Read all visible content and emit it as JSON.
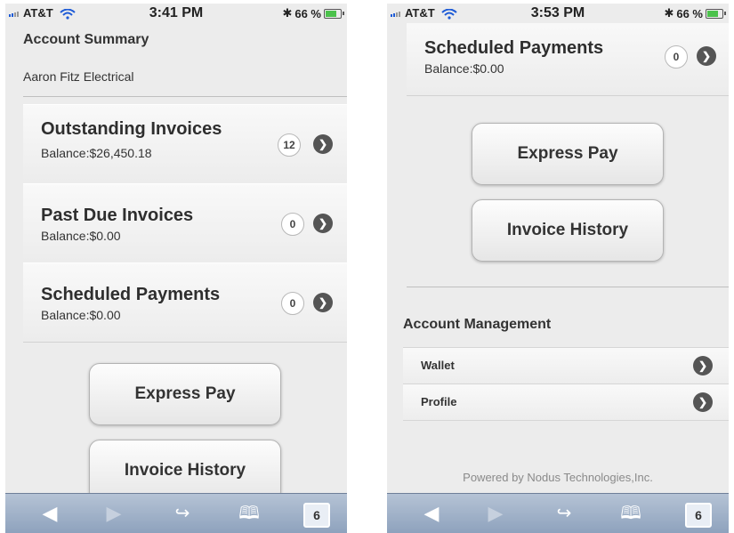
{
  "left": {
    "status": {
      "carrier": "AT&T",
      "time": "3:41 PM",
      "battery": "66 %"
    },
    "title": "Account Summary",
    "account_name": "Aaron Fitz Electrical",
    "rows": [
      {
        "title": "Outstanding Invoices",
        "balance": "Balance:$26,450.18",
        "count": "12"
      },
      {
        "title": "Past Due Invoices",
        "balance": "Balance:$0.00",
        "count": "0"
      },
      {
        "title": "Scheduled Payments",
        "balance": "Balance:$0.00",
        "count": "0"
      }
    ],
    "buttons": {
      "express_pay": "Express Pay",
      "invoice_history": "Invoice History"
    }
  },
  "right": {
    "status": {
      "carrier": "AT&T",
      "time": "3:53 PM",
      "battery": "66 %"
    },
    "row": {
      "title": "Scheduled Payments",
      "balance": "Balance:$0.00",
      "count": "0"
    },
    "buttons": {
      "express_pay": "Express Pay",
      "invoice_history": "Invoice History"
    },
    "management": {
      "title": "Account Management",
      "items": [
        {
          "label": "Wallet"
        },
        {
          "label": "Profile"
        }
      ]
    },
    "footer": "Powered by Nodus Technologies,Inc."
  },
  "toolbar": {
    "tabs_count": "6"
  },
  "icons": [
    "back-icon",
    "forward-icon",
    "share-icon",
    "bookmarks-icon",
    "tabs-icon",
    "chevron-right-icon",
    "wifi-icon",
    "bluetooth-icon",
    "battery-icon",
    "signal-icon"
  ],
  "colors": {
    "background": "#ececec",
    "toolbar": "#9fb0c8",
    "chevron": "#555555",
    "battery": "#4cc24c"
  }
}
